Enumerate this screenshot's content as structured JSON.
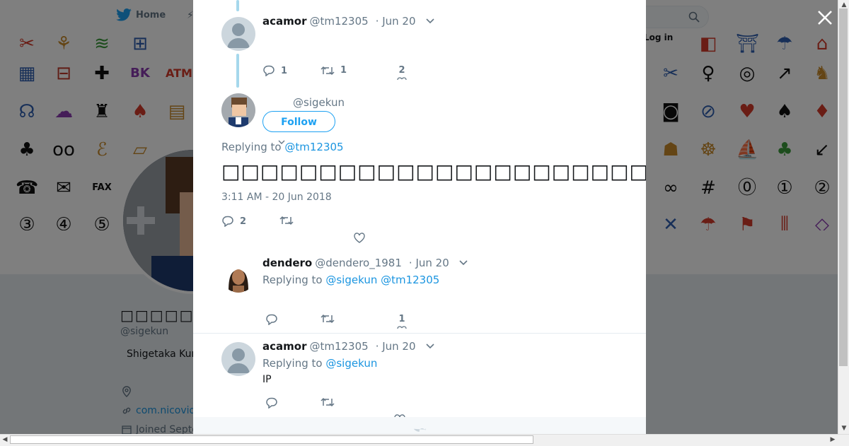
{
  "nav": {
    "home_label": "Home",
    "login_label": "Log in"
  },
  "profile": {
    "name": "□□□□□□□□",
    "handle": "@sigekun",
    "bio": "Shigetaka Kur",
    "link": "com.nicovid",
    "joined": "Joined Septe"
  },
  "thread": {
    "t1": {
      "name": "acamor",
      "handle": "@tm12305",
      "time": "· Jun 20",
      "replies": "1",
      "retweets": "1",
      "likes": "2"
    },
    "main": {
      "handle": "@sigekun",
      "follow_label": "Follow",
      "replying_prefix": "Replying to",
      "replying_to": "@tm12305",
      "text": "□□□□□□□□□□□□□□□□□□□□□□□□□□□□□□□□□□□□□□□□□□□□□□□□□",
      "timestamp": "3:11 AM - 20 Jun 2018",
      "replies": "2"
    },
    "t3": {
      "name": "dendero",
      "handle": "@dendero_1981",
      "time": "· Jun 20",
      "replying_prefix": "Replying to",
      "replying_to": "@sigekun @tm12305",
      "likes": "1"
    },
    "t4": {
      "name": "acamor",
      "handle": "@tm12305",
      "time": "· Jun 20",
      "replying_prefix": "Replying to",
      "replying_to": "@sigekun",
      "text": "IP"
    }
  },
  "colors": {
    "accent": "#1da1f2",
    "link": "#1b95e0",
    "thread_line": "#a6d8ec",
    "muted": "#657786"
  },
  "icons": [
    "twitter-bird-icon",
    "search-icon",
    "close-icon",
    "reply-icon",
    "retweet-icon",
    "like-icon",
    "caret-down-icon",
    "location-icon",
    "link-icon",
    "calendar-icon"
  ]
}
